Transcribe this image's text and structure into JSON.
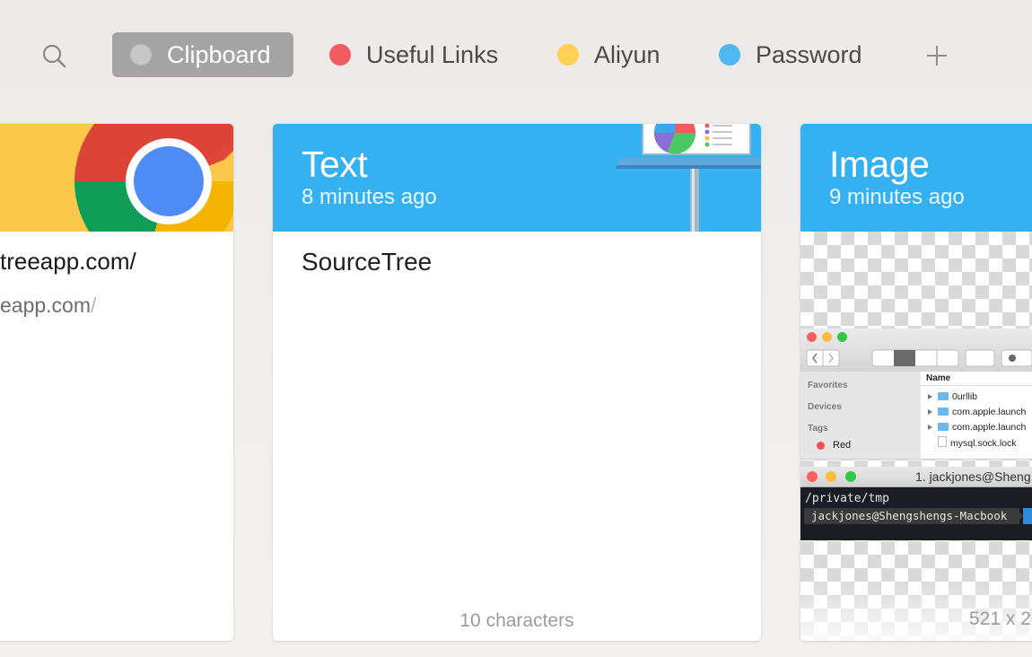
{
  "toolbar": {
    "search_icon": "search-icon",
    "add_icon": "plus-icon",
    "tabs": [
      {
        "label": "Clipboard",
        "color": "#c7c7c7",
        "active": true
      },
      {
        "label": "Useful Links",
        "color": "#f25b5f"
      },
      {
        "label": "Aliyun",
        "color": "#fdd152"
      },
      {
        "label": "Password",
        "color": "#4db8f1"
      }
    ]
  },
  "cards": {
    "link": {
      "title": "treeapp.com/",
      "url": "eapp.com",
      "url_slash": "/",
      "header_color": "#fbc84b",
      "icon": "chrome-icon"
    },
    "text": {
      "title": "Text",
      "time": "8 minutes ago",
      "content": "SourceTree",
      "footer": "10 characters",
      "header_color": "#35b0f0",
      "icon": "keynote-icon"
    },
    "image": {
      "title": "Image",
      "time": "9 minutes ago",
      "footer": "521 x 2",
      "header_color": "#35b0f0",
      "finder": {
        "favorites": "Favorites",
        "devices": "Devices",
        "tags": "Tags",
        "tag_red": "Red",
        "column_name": "Name",
        "rows": [
          "0urllib",
          "com.apple.launch",
          "com.apple.launch",
          "mysql.sock.lock"
        ]
      },
      "terminal": {
        "title": "1. jackjones@Sheng",
        "line1": "/private/tmp",
        "prompt": "jackjones@Shengshengs-Macbook"
      }
    }
  }
}
